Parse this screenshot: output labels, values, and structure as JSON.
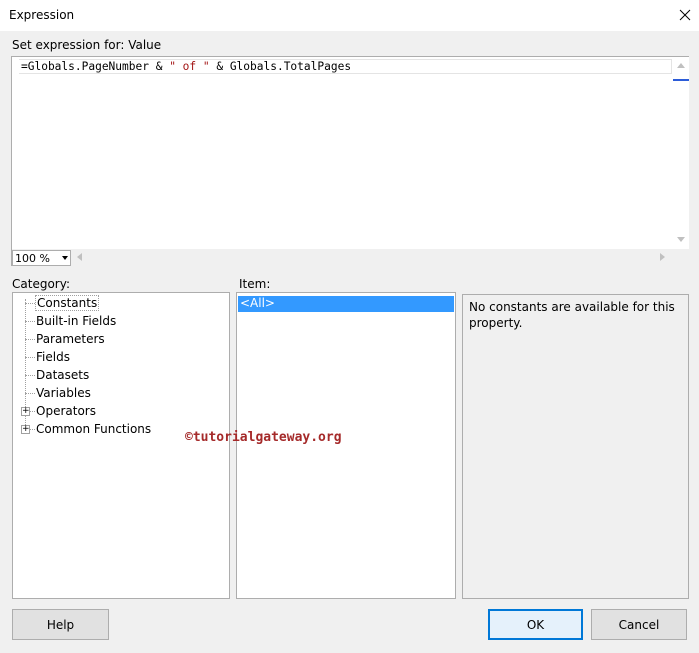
{
  "window": {
    "title": "Expression"
  },
  "editor": {
    "label": "Set expression for: Value",
    "code_part1": "=Globals.PageNumber & ",
    "code_string": "\" of \"",
    "code_part2": " & Globals.TotalPages",
    "zoom": "100 %"
  },
  "category": {
    "label": "Category:",
    "items": [
      {
        "label": "Constants",
        "selected": true,
        "expandable": false
      },
      {
        "label": "Built-in Fields",
        "expandable": false
      },
      {
        "label": "Parameters",
        "expandable": false
      },
      {
        "label": "Fields",
        "expandable": false
      },
      {
        "label": "Datasets",
        "expandable": false
      },
      {
        "label": "Variables",
        "expandable": false
      },
      {
        "label": "Operators",
        "expandable": true
      },
      {
        "label": "Common Functions",
        "expandable": true
      }
    ]
  },
  "item": {
    "label": "Item:",
    "items": [
      "<All>"
    ]
  },
  "description": {
    "text": "No constants are available for this property."
  },
  "watermark": "©tutorialgateway.org",
  "buttons": {
    "help": "Help",
    "ok": "OK",
    "cancel": "Cancel"
  },
  "icons": {
    "close": "close-icon",
    "expand": "plus-expander-icon"
  },
  "colors": {
    "selection": "#3399ff",
    "accent": "#0078d7",
    "string_literal": "#a31515"
  }
}
